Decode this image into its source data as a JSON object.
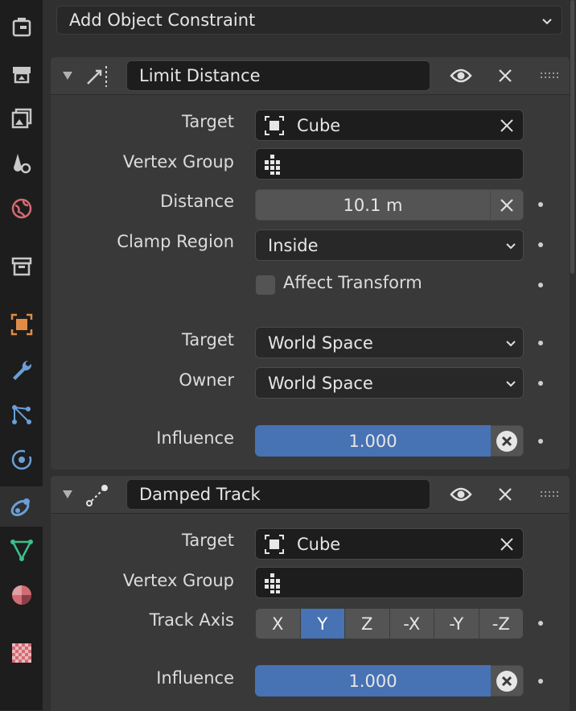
{
  "add_constraint": {
    "label": "Add Object Constraint"
  },
  "constraints": [
    {
      "name": "Limit Distance",
      "fields": {
        "target_label": "Target",
        "target_value": "Cube",
        "vertex_group_label": "Vertex Group",
        "vertex_group_value": "",
        "distance_label": "Distance",
        "distance_value": "10.1 m",
        "clamp_label": "Clamp Region",
        "clamp_value": "Inside",
        "affect_transform_label": "Affect Transform",
        "affect_transform_checked": false,
        "target_space_label": "Target",
        "target_space_value": "World Space",
        "owner_space_label": "Owner",
        "owner_space_value": "World Space",
        "influence_label": "Influence",
        "influence_value": "1.000"
      }
    },
    {
      "name": "Damped Track",
      "fields": {
        "target_label": "Target",
        "target_value": "Cube",
        "vertex_group_label": "Vertex Group",
        "vertex_group_value": "",
        "track_axis_label": "Track Axis",
        "track_axis_options": [
          "X",
          "Y",
          "Z",
          "-X",
          "-Y",
          "-Z"
        ],
        "track_axis_selected": "Y",
        "influence_label": "Influence",
        "influence_value": "1.000"
      }
    }
  ],
  "colors": {
    "accent": "#4772b3",
    "object_tab_orange": "#e08c46",
    "constraint_tab_blue": "#6a9fd8",
    "mesh_tab_green": "#3bc08a",
    "world_tab_red": "#d36b73"
  },
  "property_tabs": [
    {
      "icon": "tool-icon"
    },
    {
      "icon": "render-icon"
    },
    {
      "icon": "output-icon"
    },
    {
      "icon": "view-layer-icon"
    },
    {
      "icon": "scene-icon"
    },
    {
      "icon": "world-icon"
    },
    {
      "icon": "collection-icon"
    },
    {
      "icon": "object-icon"
    },
    {
      "icon": "modifier-wrench-icon"
    },
    {
      "icon": "particles-icon"
    },
    {
      "icon": "physics-icon"
    },
    {
      "icon": "object-constraint-icon",
      "active": true
    },
    {
      "icon": "object-data-mesh-icon"
    },
    {
      "icon": "material-icon"
    },
    {
      "icon": "texture-icon"
    }
  ]
}
